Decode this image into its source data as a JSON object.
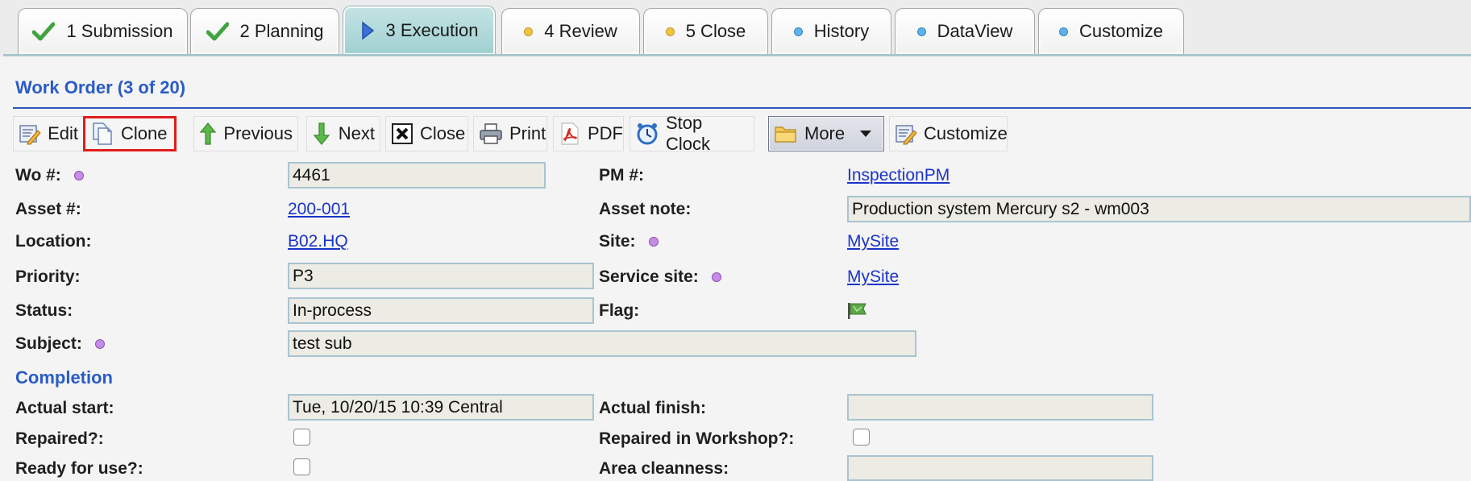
{
  "tabs": [
    {
      "label": "1 Submission",
      "icon": "check-icon"
    },
    {
      "label": "2 Planning",
      "icon": "check-icon"
    },
    {
      "label": "3 Execution",
      "icon": "play-arrow-icon",
      "active": true
    },
    {
      "label": "4 Review",
      "icon": "yellow-dot-icon"
    },
    {
      "label": "5 Close",
      "icon": "yellow-dot-icon"
    },
    {
      "label": "History",
      "icon": "blue-dot-icon"
    },
    {
      "label": "DataView",
      "icon": "blue-dot-icon"
    },
    {
      "label": "Customize",
      "icon": "blue-dot-icon"
    }
  ],
  "header": {
    "title": "Work Order (3 of 20)"
  },
  "toolbar": {
    "edit": "Edit",
    "clone": "Clone",
    "previous": "Previous",
    "next": "Next",
    "close": "Close",
    "print": "Print",
    "pdf": "PDF",
    "stop_clock": "Stop Clock",
    "more": "More",
    "customize": "Customize"
  },
  "form": {
    "wo_label": "Wo #:",
    "wo_value": "4461",
    "pm_label": "PM #:",
    "pm_value": "InspectionPM",
    "asset_label": "Asset #:",
    "asset_value": "200-001",
    "asset_note_label": "Asset note:",
    "asset_note_value": "Production system Mercury s2 - wm003",
    "location_label": "Location:",
    "location_value": "B02.HQ",
    "site_label": "Site:",
    "site_value": "MySite",
    "priority_label": "Priority:",
    "priority_value": "P3",
    "service_site_label": "Service site:",
    "service_site_value": "MySite",
    "status_label": "Status:",
    "status_value": "In-process",
    "flag_label": "Flag:",
    "subject_label": "Subject:",
    "subject_value": "test sub"
  },
  "completion": {
    "title": "Completion",
    "actual_start_label": "Actual start:",
    "actual_start_value": "Tue, 10/20/15 10:39 Central",
    "actual_finish_label": "Actual finish:",
    "actual_finish_value": "",
    "repaired_label": "Repaired?:",
    "repaired_workshop_label": "Repaired in Workshop?:",
    "ready_label": "Ready for use?:",
    "area_cleanness_label": "Area cleanness:",
    "area_cleanness_value": ""
  },
  "colors": {
    "accent": "#2a5cc6",
    "active_tab": "#a9d5d6",
    "highlight_border": "#e01c1c",
    "link": "#1a35c9"
  }
}
